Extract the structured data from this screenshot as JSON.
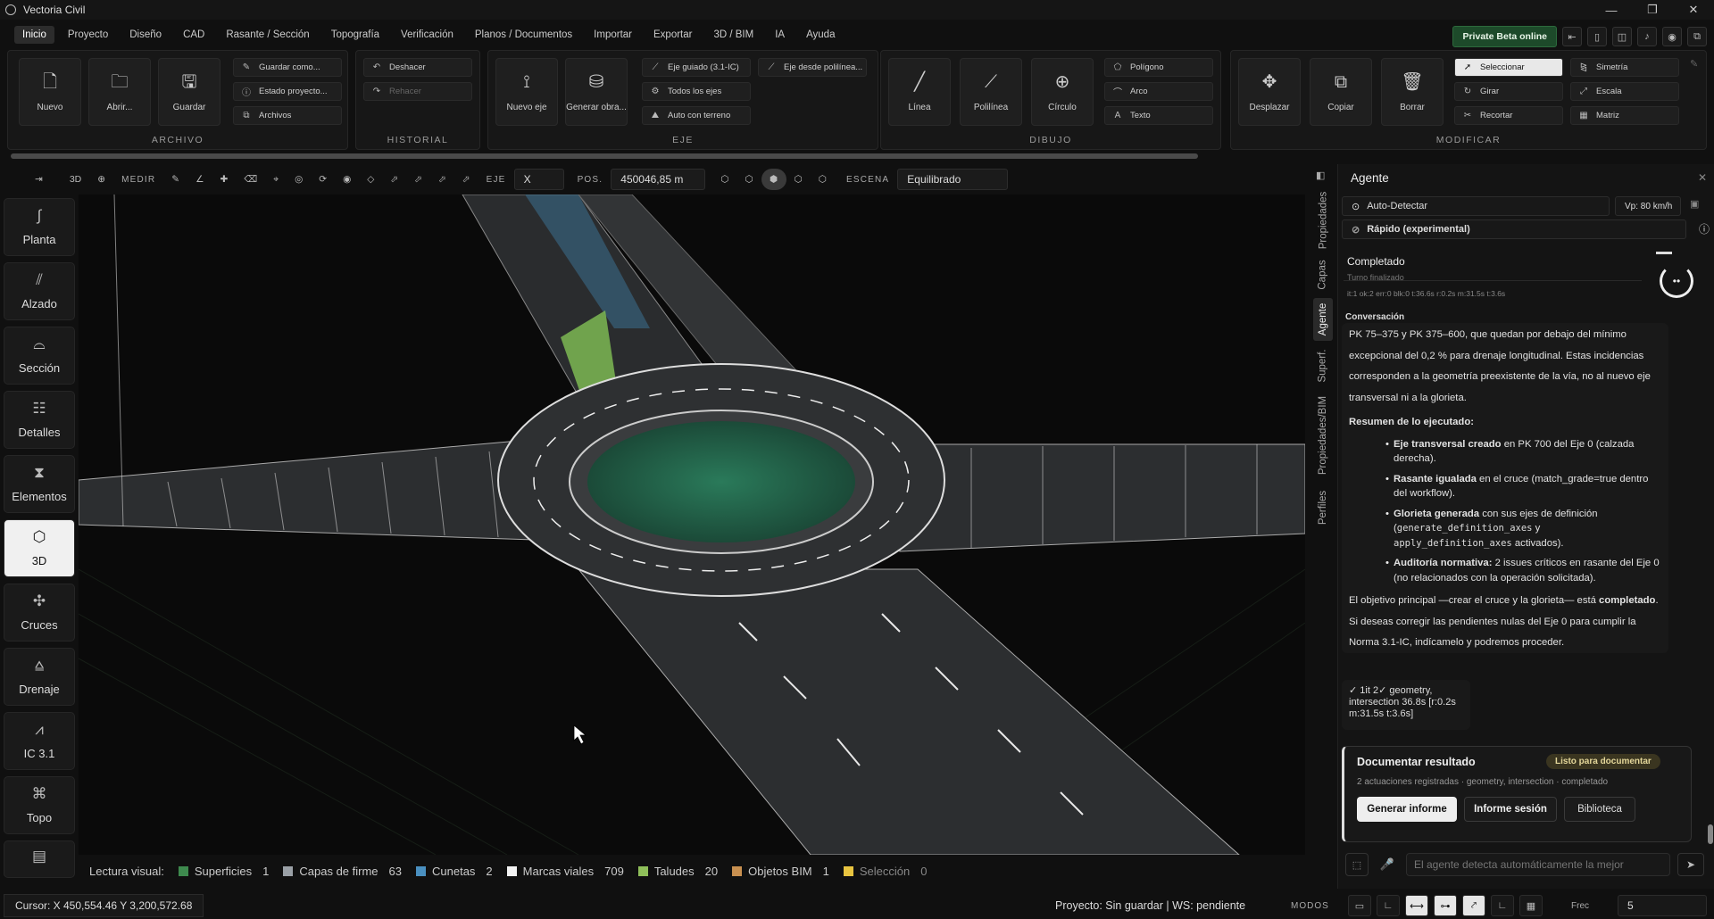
{
  "window": {
    "title": "Vectoria Civil"
  },
  "menu": {
    "items": [
      "Inicio",
      "Proyecto",
      "Diseño",
      "CAD",
      "Rasante / Sección",
      "Topografía",
      "Verificación",
      "Planos / Documentos",
      "Importar",
      "Exportar",
      "3D / BIM",
      "IA",
      "Ayuda"
    ],
    "beta_label": "Private Beta online"
  },
  "ribbon": {
    "archivo": {
      "title": "ARCHIVO",
      "nuevo": "Nuevo",
      "abrir": "Abrir...",
      "guardar": "Guardar",
      "guardar_como": "Guardar como...",
      "estado": "Estado proyecto...",
      "archivos": "Archivos"
    },
    "historial": {
      "title": "HISTORIAL",
      "deshacer": "Deshacer",
      "rehacer": "Rehacer"
    },
    "eje": {
      "title": "EJE",
      "nuevo_eje": "Nuevo eje",
      "generar_obra": "Generar obra...",
      "eje_guiado": "Eje guiado (3.1-IC)",
      "eje_polilinea": "Eje desde polilínea...",
      "todos_ejes": "Todos los ejes",
      "auto_terreno": "Auto con terreno"
    },
    "dibujo": {
      "title": "DIBUJO",
      "linea": "Línea",
      "polilinea": "Polilínea",
      "circulo": "Círculo",
      "poligono": "Polígono",
      "arco": "Arco",
      "texto": "Texto"
    },
    "modificar": {
      "title": "MODIFICAR",
      "desplazar": "Desplazar",
      "copiar": "Copiar",
      "borrar": "Borrar",
      "seleccionar": "Seleccionar",
      "simetria": "Simetría",
      "girar": "Girar",
      "escala": "Escala",
      "recortar": "Recortar",
      "matriz": "Matriz"
    }
  },
  "toolbar": {
    "mode_3d": "3D",
    "medir": "MEDIR",
    "eje_label": "EJE",
    "eje_value": "X",
    "pos_label": "POS.",
    "pos_value": "450046,85 m",
    "escena_label": "ESCENA",
    "escena_value": "Equilibrado"
  },
  "sidenav": [
    "Planta",
    "Alzado",
    "Sección",
    "Detalles",
    "Elementos",
    "3D",
    "Cruces",
    "Drenaje",
    "IC 3.1",
    "Topo"
  ],
  "legend": {
    "label": "Lectura visual:",
    "items": [
      {
        "name": "Superficies",
        "count": "1",
        "color": "#3e8a4e"
      },
      {
        "name": "Capas de firme",
        "count": "63",
        "color": "#9aa0a6"
      },
      {
        "name": "Cunetas",
        "count": "2",
        "color": "#4a90c0"
      },
      {
        "name": "Marcas viales",
        "count": "709",
        "color": "#f2f2f2"
      },
      {
        "name": "Taludes",
        "count": "20",
        "color": "#8fbf5a"
      },
      {
        "name": "Objetos BIM",
        "count": "1",
        "color": "#c89050"
      },
      {
        "name": "Selección",
        "count": "0",
        "color": "#e8c440"
      }
    ]
  },
  "status": {
    "cursor": "Cursor: X 450,554.46  Y 3,200,572.68",
    "project": "Proyecto: Sin guardar | WS: pendiente",
    "modos": "MODOS",
    "frec_label": "Frec",
    "frec_value": "5"
  },
  "panel_tabs": [
    "Propiedades",
    "Capas",
    "Agente",
    "Superf.",
    "Propiedades/BIM",
    "Perfiles"
  ],
  "agent": {
    "title": "Agente",
    "detect": "Auto-Detectar",
    "speed": "Vp: 80 km/h",
    "model": "Rápido (experimental)",
    "status_title": "Completado",
    "status_sub": "Turno finalizado",
    "status_metrics": "it:1 ok:2 err:0 blk:0 t:36.6s  r:0.2s m:31.5s t:3.6s",
    "conversation_label": "Conversación",
    "p1": "PK 75–375 y PK 375–600, que quedan por debajo del mínimo excepcional del 0,2 % para drenaje longitudinal. Estas incidencias corresponden a la geometría preexistente de la vía, no al nuevo eje transversal ni a la glorieta.",
    "summary_title": "Resumen de lo ejecutado:",
    "b1_bold": "Eje transversal creado",
    "b1_rest": " en PK 700 del Eje 0 (calzada derecha).",
    "b2_bold": "Rasante igualada",
    "b2_rest": " en el cruce (match_grade=true dentro del workflow).",
    "b3_bold": "Glorieta generada",
    "b3_rest1": " con sus ejes de definición (",
    "b3_code1": "generate_definition_axes",
    "b3_mid": " y ",
    "b3_code2": "apply_definition_axes",
    "b3_rest2": " activados).",
    "b4_bold": "Auditoría normativa:",
    "b4_rest": " 2 issues críticos en rasante del Eje 0 (no relacionados con la operación solicitada).",
    "p2_a": "El objetivo principal —crear el cruce y la glorieta— está ",
    "p2_bold": "completado",
    "p2_b": ". Si deseas corregir las pendientes nulas del Eje 0 para cumplir la Norma 3.1-IC, indícamelo y podremos proceder.",
    "tool_result": "✓ 1it 2✓ geometry, intersection 36.8s [r:0.2s m:31.5s t:3.6s]",
    "doc_title": "Documentar resultado",
    "doc_badge": "Listo para documentar",
    "doc_sub": "2 actuaciones registradas · geometry, intersection · completado",
    "btn_generar": "Generar informe",
    "btn_sesion": "Informe sesión",
    "btn_biblioteca": "Biblioteca",
    "input_placeholder": "El agente detecta automáticamente la mejor"
  }
}
